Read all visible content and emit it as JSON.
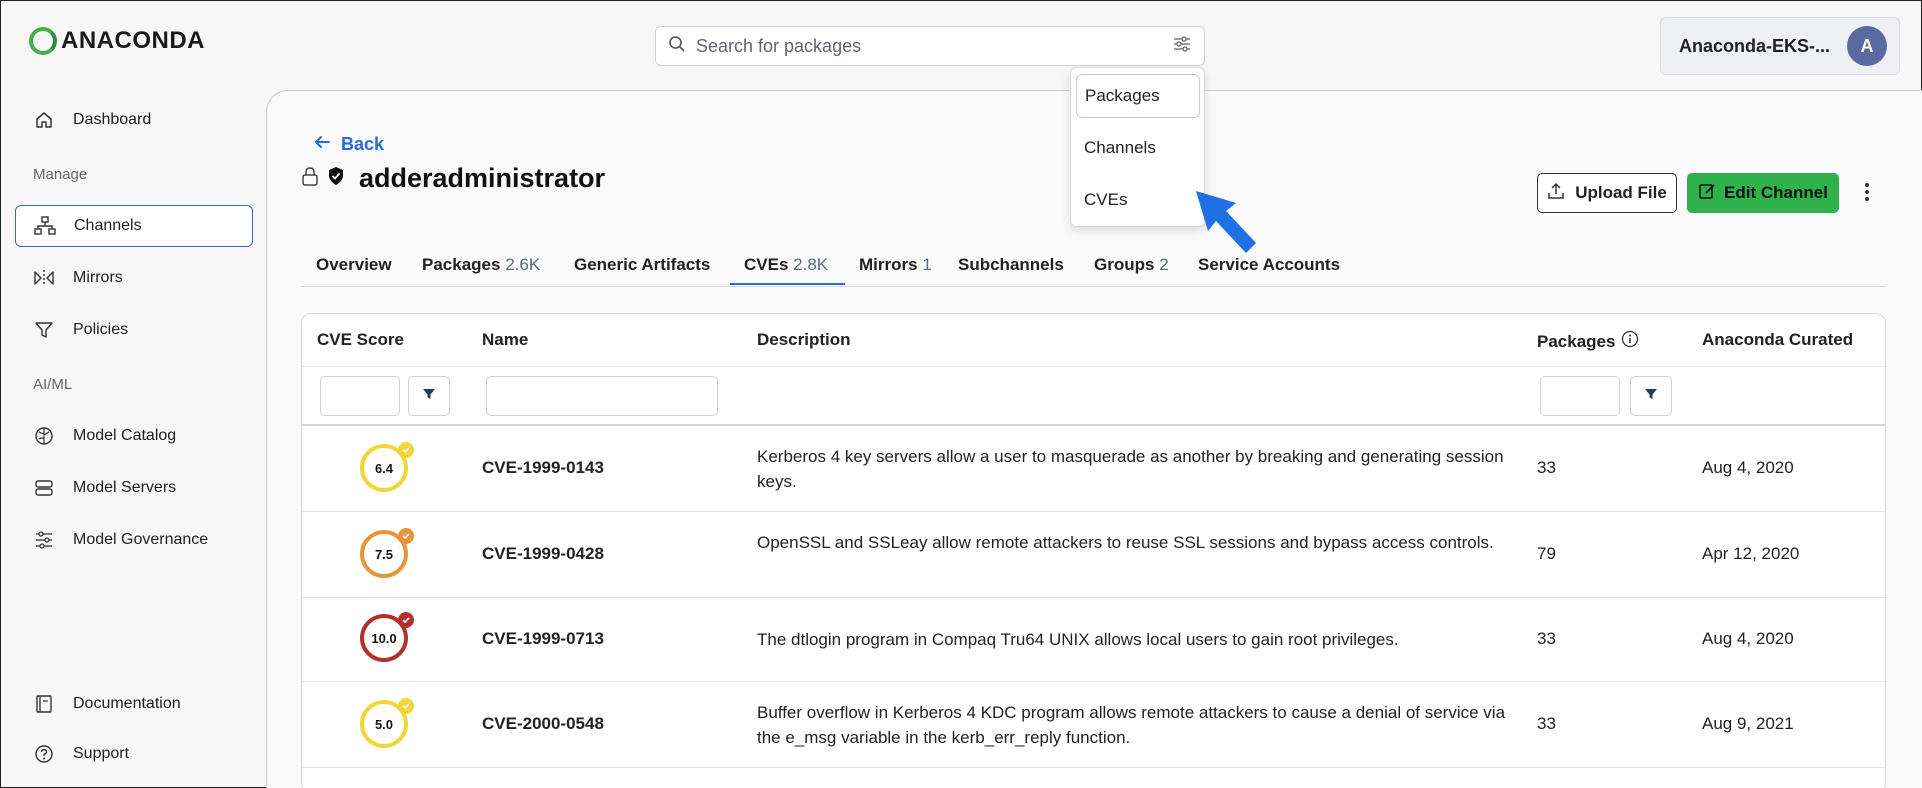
{
  "brand": {
    "name": "ANACONDA"
  },
  "search": {
    "placeholder": "Search for packages"
  },
  "account": {
    "name": "Anaconda-EKS-...",
    "avatar_initial": "A"
  },
  "search_dropdown": {
    "options": [
      "Packages",
      "Channels",
      "CVEs"
    ],
    "selected": "Packages"
  },
  "sidebar": {
    "dashboard": "Dashboard",
    "section_manage": "Manage",
    "channels": "Channels",
    "mirrors": "Mirrors",
    "policies": "Policies",
    "section_aiml": "AI/ML",
    "model_catalog": "Model Catalog",
    "model_servers": "Model Servers",
    "model_governance": "Model Governance",
    "documentation": "Documentation",
    "support": "Support"
  },
  "page": {
    "back_label": "Back",
    "title": "adderadministrator",
    "upload_label": "Upload File",
    "edit_label": "Edit Channel"
  },
  "tabs": {
    "overview": "Overview",
    "packages": "Packages",
    "packages_count": "2.6K",
    "generic": "Generic Artifacts",
    "cves": "CVEs",
    "cves_count": "2.8K",
    "mirrors": "Mirrors",
    "mirrors_count": "1",
    "subchannels": "Subchannels",
    "groups": "Groups",
    "groups_count": "2",
    "service_accounts": "Service Accounts"
  },
  "table": {
    "headers": {
      "score": "CVE Score",
      "name": "Name",
      "description": "Description",
      "packages": "Packages",
      "curated": "Anaconda Curated"
    },
    "rows": [
      {
        "score": "6.4",
        "name": "CVE-1999-0143",
        "description": "Kerberos 4 key servers allow a user to masquerade as another by breaking and generating session keys.",
        "packages": "33",
        "curated": "Aug 4, 2020",
        "color": "#f1d63a"
      },
      {
        "score": "7.5",
        "name": "CVE-1999-0428",
        "description": "OpenSSL and SSLeay allow remote attackers to reuse SSL sessions and bypass access controls.",
        "packages": "79",
        "curated": "Apr 12, 2020",
        "color": "#e8943a"
      },
      {
        "score": "10.0",
        "name": "CVE-1999-0713",
        "description": "The dtlogin program in Compaq Tru64 UNIX allows local users to gain root privileges.",
        "packages": "33",
        "curated": "Aug 4, 2020",
        "color": "#b3302c"
      },
      {
        "score": "5.0",
        "name": "CVE-2000-0548",
        "description": "Buffer overflow in Kerberos 4 KDC program allows remote attackers to cause a denial of service via the e_msg variable in the kerb_err_reply function.",
        "packages": "33",
        "curated": "Aug 9, 2021",
        "color": "#f1d63a"
      }
    ]
  },
  "colors": {
    "accent": "#2a6bd6",
    "primary_button": "#2fb24c",
    "pointer_arrow": "#1f6fe5"
  }
}
